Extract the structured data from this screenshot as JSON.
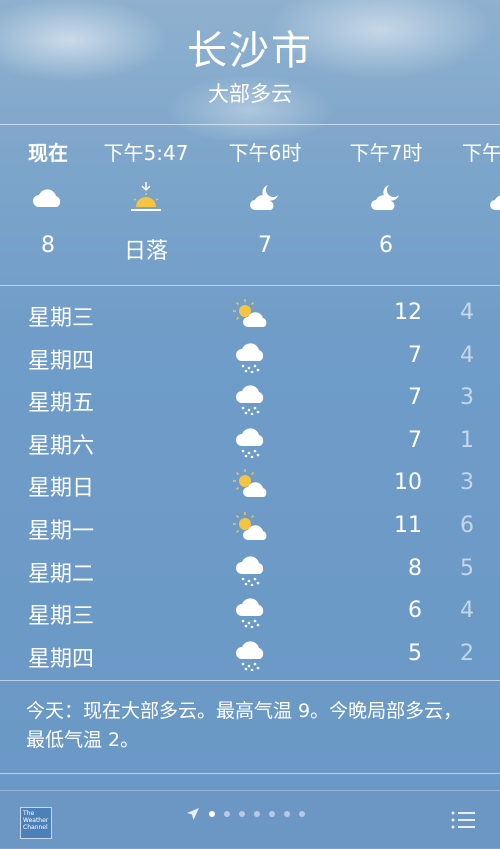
{
  "header": {
    "city": "长沙市",
    "condition": "大部多云"
  },
  "hourly": [
    {
      "time": "现在",
      "icon": "cloud-icon",
      "temp": "8",
      "now": true
    },
    {
      "time": "下午5:47",
      "icon": "sunset-icon",
      "temp": "日落"
    },
    {
      "time": "下午6时",
      "icon": "cloud-moon-icon",
      "temp": "7"
    },
    {
      "time": "下午7时",
      "icon": "cloud-moon-icon",
      "temp": "6"
    },
    {
      "time": "下午",
      "icon": "cloud-moon-icon",
      "temp": ""
    }
  ],
  "daily": [
    {
      "day": "星期三",
      "icon": "partly-sunny-icon",
      "high": "12",
      "low": "4"
    },
    {
      "day": "星期四",
      "icon": "rain-cloud-icon",
      "high": "7",
      "low": "4"
    },
    {
      "day": "星期五",
      "icon": "rain-cloud-icon",
      "high": "7",
      "low": "3"
    },
    {
      "day": "星期六",
      "icon": "rain-cloud-icon",
      "high": "7",
      "low": "1"
    },
    {
      "day": "星期日",
      "icon": "partly-sunny-icon",
      "high": "10",
      "low": "3"
    },
    {
      "day": "星期一",
      "icon": "partly-sunny-icon",
      "high": "11",
      "low": "6"
    },
    {
      "day": "星期二",
      "icon": "rain-cloud-icon",
      "high": "8",
      "low": "5"
    },
    {
      "day": "星期三",
      "icon": "rain-cloud-icon",
      "high": "6",
      "low": "4"
    },
    {
      "day": "星期四",
      "icon": "rain-cloud-icon",
      "high": "5",
      "low": "2"
    }
  ],
  "summary": {
    "text": "今天：现在大部多云。最高气温 9。今晚局部多云，最低气温 2。"
  },
  "footer": {
    "logo_text": "The Weather Channel",
    "page_count": 7,
    "active_page": 0,
    "icons": {
      "location": "location-arrow-icon",
      "list": "list-icon",
      "logo": "weather-channel-logo"
    }
  },
  "colors": {
    "background_top": "#8fb1cf",
    "background_bottom": "#6a98c6",
    "sun": "#f6c443",
    "text": "#ffffff"
  }
}
